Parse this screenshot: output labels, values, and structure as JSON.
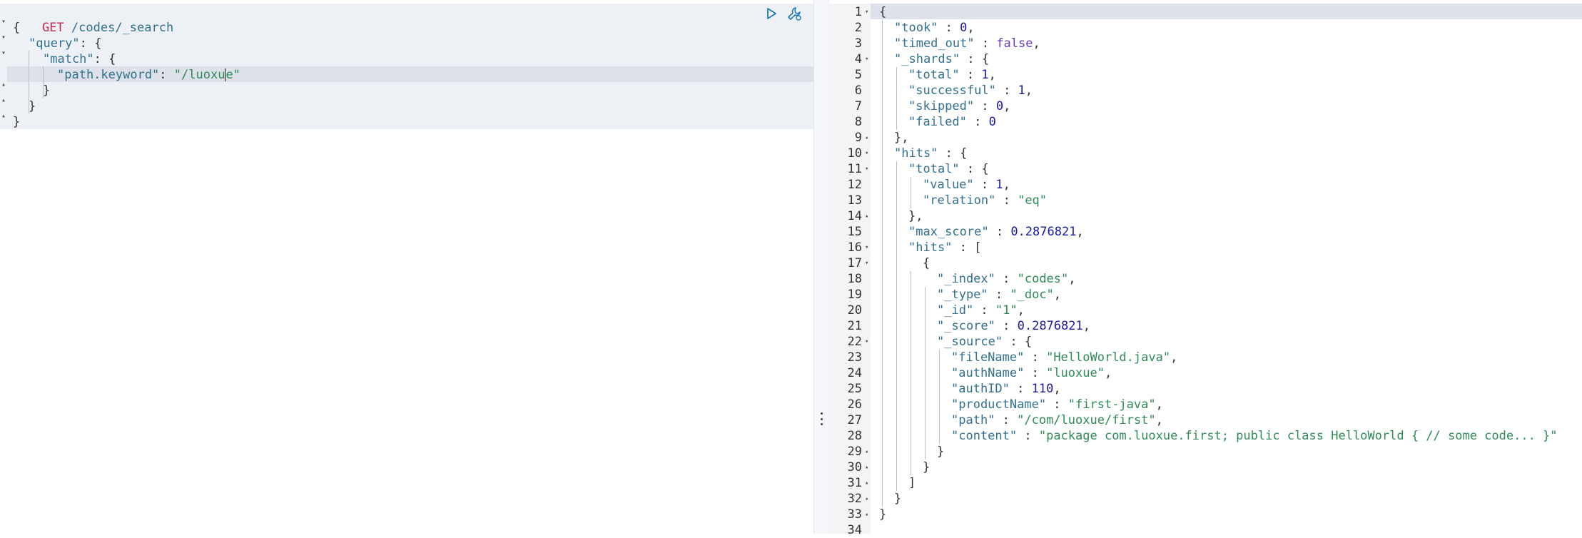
{
  "request": {
    "method": "GET",
    "path": "/codes/_search",
    "lines": [
      "{",
      "\"query\": {",
      "\"match\": {",
      "\"path.keyword\": \"/luoxue\"",
      "}",
      "}",
      "}"
    ],
    "query_key": "\"query\"",
    "match_key": "\"match\"",
    "field_key": "\"path.keyword\"",
    "field_value_before_cursor": "\"/luoxu",
    "field_value_after_cursor": "e\""
  },
  "toolbar": {
    "run_icon": "play-icon",
    "settings_icon": "wrench-icon"
  },
  "response": {
    "line_numbers": [
      "1",
      "2",
      "3",
      "4",
      "5",
      "6",
      "7",
      "8",
      "9",
      "10",
      "11",
      "12",
      "13",
      "14",
      "15",
      "16",
      "17",
      "18",
      "19",
      "20",
      "21",
      "22",
      "23",
      "24",
      "25",
      "26",
      "27",
      "28",
      "29",
      "30",
      "31",
      "32",
      "33",
      "34"
    ],
    "took": "0",
    "timed_out": "false",
    "shards_total": "1",
    "shards_successful": "1",
    "shards_skipped": "0",
    "shards_failed": "0",
    "hits_total_value": "1",
    "hits_total_relation": "\"eq\"",
    "max_score": "0.2876821",
    "hit_index": "\"codes\"",
    "hit_type": "\"_doc\"",
    "hit_id": "\"1\"",
    "hit_score": "0.2876821",
    "source_fileName": "\"HelloWorld.java\"",
    "source_authName": "\"luoxue\"",
    "source_authID": "110",
    "source_productName": "\"first-java\"",
    "source_path": "\"/com/luoxue/first\"",
    "source_content": "\"package com.luoxue.first; public class HelloWorld { // some code... }\""
  }
}
